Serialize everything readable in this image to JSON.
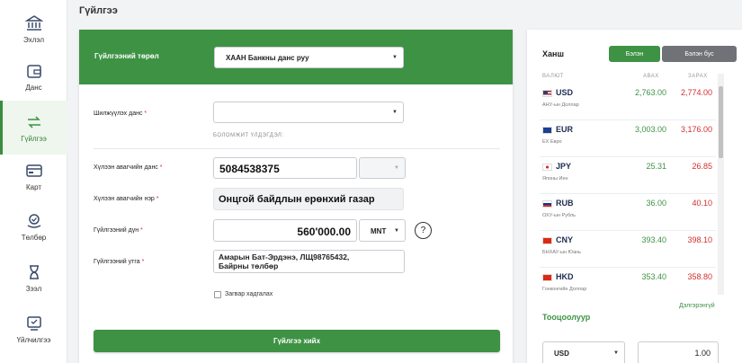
{
  "sidebar": {
    "items": [
      {
        "label": "Эхлэл",
        "icon": "bank-icon"
      },
      {
        "label": "Данс",
        "icon": "wallet-icon"
      },
      {
        "label": "Гүйлгээ",
        "icon": "transfer-icon"
      },
      {
        "label": "Карт",
        "icon": "card-icon"
      },
      {
        "label": "Төлбөр",
        "icon": "payment-icon"
      },
      {
        "label": "Зээл",
        "icon": "loan-icon"
      },
      {
        "label": "Үйлчилгээ",
        "icon": "services-icon"
      }
    ],
    "active_index": 2,
    "accent": "#3e9244"
  },
  "page_title": "Гүйлгээ",
  "form": {
    "type_label": "Гүйлгээний төрөл",
    "type_value": "ХААН Банкны данс руу",
    "from_label": "Шилжүүлэх данс",
    "from_value": "",
    "available_label": "БОЛОМЖИТ ҮЛДЭГДЭЛ:",
    "to_account_label": "Хүлээн авагчийн данс",
    "to_account_value": "5084538375",
    "to_name_label": "Хүлээн авагчийн нэр",
    "to_name_value": "Онцгой байдлын ерөнхий газар",
    "amount_label": "Гүйлгээний дүн",
    "amount_value": "560'000.00",
    "currency_value": "MNT",
    "help_icon_text": "?",
    "desc_label": "Гүйлгээний утга",
    "desc_value": "Амарын Бат-Эрдэнэ, ЛЩ98765432,\nБайрны төлбөр",
    "save_template_label": "Загвар хадгалах",
    "submit_label": "Гүйлгээ хийх",
    "required_mark": "*"
  },
  "rates": {
    "title": "Ханш",
    "toggle_cash": "Бэлэн",
    "toggle_noncash": "Бэлэн бус",
    "col_currency": "ВАЛЮТ",
    "col_buy": "АВАХ",
    "col_sell": "ЗАРАХ",
    "rows": [
      {
        "code": "USD",
        "name": "АНУ-ын Доллар",
        "buy": "2,763.00",
        "sell": "2,774.00",
        "flag": "usa-flag-icon"
      },
      {
        "code": "EUR",
        "name": "EX Евро",
        "buy": "3,003.00",
        "sell": "3,176.00",
        "flag": "eu-flag-icon"
      },
      {
        "code": "JPY",
        "name": "Японы Иен",
        "buy": "25.31",
        "sell": "26.85",
        "flag": "japan-flag-icon"
      },
      {
        "code": "RUB",
        "name": "ОХУ-ын Рубль",
        "buy": "36.00",
        "sell": "40.10",
        "flag": "russia-flag-icon"
      },
      {
        "code": "CNY",
        "name": "БНХАУ-ын Юань",
        "buy": "393.40",
        "sell": "398.10",
        "flag": "china-flag-icon"
      },
      {
        "code": "HKD",
        "name": "Гонконгийн Доллар",
        "buy": "353.40",
        "sell": "358.80",
        "flag": "hongkong-flag-icon"
      }
    ],
    "detail_link": "Дэлгэрэнгүй"
  },
  "calculator": {
    "title": "Тооцоолуур",
    "currency_value": "USD",
    "amount_value": "1.00"
  }
}
